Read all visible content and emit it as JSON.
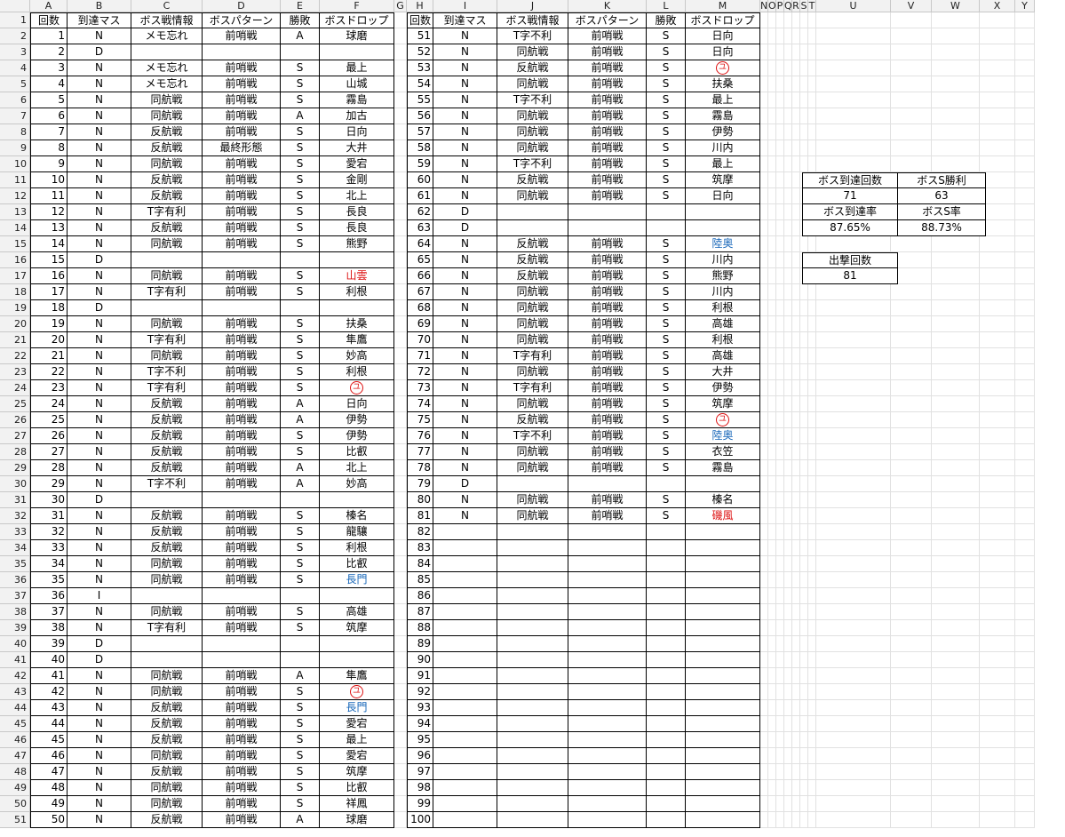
{
  "columns": [
    "A",
    "B",
    "C",
    "D",
    "E",
    "F",
    "G",
    "H",
    "I",
    "J",
    "K",
    "L",
    "M",
    "N",
    "O",
    "P",
    "Q",
    "R",
    "S",
    "T",
    "U",
    "V",
    "W",
    "X",
    "Y"
  ],
  "header1": [
    "回数",
    "到達マス",
    "ボス戦情報",
    "ボスパターン",
    "勝敗",
    "ボスドロップ"
  ],
  "table1": [
    [
      1,
      "N",
      "メモ忘れ",
      "前哨戦",
      "A",
      "球磨"
    ],
    [
      2,
      "D",
      "",
      "",
      "",
      ""
    ],
    [
      3,
      "N",
      "メモ忘れ",
      "前哨戦",
      "S",
      "最上"
    ],
    [
      4,
      "N",
      "メモ忘れ",
      "前哨戦",
      "S",
      "山城"
    ],
    [
      5,
      "N",
      "同航戦",
      "前哨戦",
      "S",
      "霧島"
    ],
    [
      6,
      "N",
      "同航戦",
      "前哨戦",
      "A",
      "加古"
    ],
    [
      7,
      "N",
      "反航戦",
      "前哨戦",
      "S",
      "日向"
    ],
    [
      8,
      "N",
      "反航戦",
      "最終形態",
      "S",
      "大井"
    ],
    [
      9,
      "N",
      "同航戦",
      "前哨戦",
      "S",
      "愛宕"
    ],
    [
      10,
      "N",
      "反航戦",
      "前哨戦",
      "S",
      "金剛"
    ],
    [
      11,
      "N",
      "反航戦",
      "前哨戦",
      "S",
      "北上"
    ],
    [
      12,
      "N",
      "T字有利",
      "前哨戦",
      "S",
      "長良"
    ],
    [
      13,
      "N",
      "反航戦",
      "前哨戦",
      "S",
      "長良"
    ],
    [
      14,
      "N",
      "同航戦",
      "前哨戦",
      "S",
      "熊野"
    ],
    [
      15,
      "D",
      "",
      "",
      "",
      ""
    ],
    [
      16,
      "N",
      "同航戦",
      "前哨戦",
      "S",
      "山雲"
    ],
    [
      17,
      "N",
      "T字有利",
      "前哨戦",
      "S",
      "利根"
    ],
    [
      18,
      "D",
      "",
      "",
      "",
      ""
    ],
    [
      19,
      "N",
      "同航戦",
      "前哨戦",
      "S",
      "扶桑"
    ],
    [
      20,
      "N",
      "T字有利",
      "前哨戦",
      "S",
      "隼鷹"
    ],
    [
      21,
      "N",
      "同航戦",
      "前哨戦",
      "S",
      "妙高"
    ],
    [
      22,
      "N",
      "T字不利",
      "前哨戦",
      "S",
      "利根"
    ],
    [
      23,
      "N",
      "T字有利",
      "前哨戦",
      "S",
      "ユ"
    ],
    [
      24,
      "N",
      "反航戦",
      "前哨戦",
      "A",
      "日向"
    ],
    [
      25,
      "N",
      "反航戦",
      "前哨戦",
      "A",
      "伊勢"
    ],
    [
      26,
      "N",
      "反航戦",
      "前哨戦",
      "S",
      "伊勢"
    ],
    [
      27,
      "N",
      "反航戦",
      "前哨戦",
      "S",
      "比叡"
    ],
    [
      28,
      "N",
      "反航戦",
      "前哨戦",
      "A",
      "北上"
    ],
    [
      29,
      "N",
      "T字不利",
      "前哨戦",
      "A",
      "妙高"
    ],
    [
      30,
      "D",
      "",
      "",
      "",
      ""
    ],
    [
      31,
      "N",
      "反航戦",
      "前哨戦",
      "S",
      "榛名"
    ],
    [
      32,
      "N",
      "反航戦",
      "前哨戦",
      "S",
      "龍驤"
    ],
    [
      33,
      "N",
      "反航戦",
      "前哨戦",
      "S",
      "利根"
    ],
    [
      34,
      "N",
      "同航戦",
      "前哨戦",
      "S",
      "比叡"
    ],
    [
      35,
      "N",
      "同航戦",
      "前哨戦",
      "S",
      "長門"
    ],
    [
      36,
      "I",
      "",
      "",
      "",
      ""
    ],
    [
      37,
      "N",
      "同航戦",
      "前哨戦",
      "S",
      "高雄"
    ],
    [
      38,
      "N",
      "T字有利",
      "前哨戦",
      "S",
      "筑摩"
    ],
    [
      39,
      "D",
      "",
      "",
      "",
      ""
    ],
    [
      40,
      "D",
      "",
      "",
      "",
      ""
    ],
    [
      41,
      "N",
      "同航戦",
      "前哨戦",
      "A",
      "隼鷹"
    ],
    [
      42,
      "N",
      "同航戦",
      "前哨戦",
      "S",
      "ユ"
    ],
    [
      43,
      "N",
      "反航戦",
      "前哨戦",
      "S",
      "長門"
    ],
    [
      44,
      "N",
      "反航戦",
      "前哨戦",
      "S",
      "愛宕"
    ],
    [
      45,
      "N",
      "反航戦",
      "前哨戦",
      "S",
      "最上"
    ],
    [
      46,
      "N",
      "同航戦",
      "前哨戦",
      "S",
      "愛宕"
    ],
    [
      47,
      "N",
      "反航戦",
      "前哨戦",
      "S",
      "筑摩"
    ],
    [
      48,
      "N",
      "同航戦",
      "前哨戦",
      "S",
      "比叡"
    ],
    [
      49,
      "N",
      "同航戦",
      "前哨戦",
      "S",
      "祥鳳"
    ],
    [
      50,
      "N",
      "反航戦",
      "前哨戦",
      "A",
      "球磨"
    ]
  ],
  "table2": [
    [
      51,
      "N",
      "T字不利",
      "前哨戦",
      "S",
      "日向"
    ],
    [
      52,
      "N",
      "同航戦",
      "前哨戦",
      "S",
      "日向"
    ],
    [
      53,
      "N",
      "反航戦",
      "前哨戦",
      "S",
      "ユ"
    ],
    [
      54,
      "N",
      "同航戦",
      "前哨戦",
      "S",
      "扶桑"
    ],
    [
      55,
      "N",
      "T字不利",
      "前哨戦",
      "S",
      "最上"
    ],
    [
      56,
      "N",
      "同航戦",
      "前哨戦",
      "S",
      "霧島"
    ],
    [
      57,
      "N",
      "同航戦",
      "前哨戦",
      "S",
      "伊勢"
    ],
    [
      58,
      "N",
      "同航戦",
      "前哨戦",
      "S",
      "川内"
    ],
    [
      59,
      "N",
      "T字不利",
      "前哨戦",
      "S",
      "最上"
    ],
    [
      60,
      "N",
      "反航戦",
      "前哨戦",
      "S",
      "筑摩"
    ],
    [
      61,
      "N",
      "同航戦",
      "前哨戦",
      "S",
      "日向"
    ],
    [
      62,
      "D",
      "",
      "",
      "",
      ""
    ],
    [
      63,
      "D",
      "",
      "",
      "",
      ""
    ],
    [
      64,
      "N",
      "反航戦",
      "前哨戦",
      "S",
      "陸奥"
    ],
    [
      65,
      "N",
      "反航戦",
      "前哨戦",
      "S",
      "川内"
    ],
    [
      66,
      "N",
      "反航戦",
      "前哨戦",
      "S",
      "熊野"
    ],
    [
      67,
      "N",
      "同航戦",
      "前哨戦",
      "S",
      "川内"
    ],
    [
      68,
      "N",
      "同航戦",
      "前哨戦",
      "S",
      "利根"
    ],
    [
      69,
      "N",
      "同航戦",
      "前哨戦",
      "S",
      "高雄"
    ],
    [
      70,
      "N",
      "同航戦",
      "前哨戦",
      "S",
      "利根"
    ],
    [
      71,
      "N",
      "T字有利",
      "前哨戦",
      "S",
      "高雄"
    ],
    [
      72,
      "N",
      "同航戦",
      "前哨戦",
      "S",
      "大井"
    ],
    [
      73,
      "N",
      "T字有利",
      "前哨戦",
      "S",
      "伊勢"
    ],
    [
      74,
      "N",
      "同航戦",
      "前哨戦",
      "S",
      "筑摩"
    ],
    [
      75,
      "N",
      "反航戦",
      "前哨戦",
      "S",
      "ユ"
    ],
    [
      76,
      "N",
      "T字不利",
      "前哨戦",
      "S",
      "陸奥"
    ],
    [
      77,
      "N",
      "同航戦",
      "前哨戦",
      "S",
      "衣笠"
    ],
    [
      78,
      "N",
      "同航戦",
      "前哨戦",
      "S",
      "霧島"
    ],
    [
      79,
      "D",
      "",
      "",
      "",
      ""
    ],
    [
      80,
      "N",
      "同航戦",
      "前哨戦",
      "S",
      "榛名"
    ],
    [
      81,
      "N",
      "同航戦",
      "前哨戦",
      "S",
      "磯風"
    ],
    [
      82,
      "",
      "",
      "",
      "",
      ""
    ],
    [
      83,
      "",
      "",
      "",
      "",
      ""
    ],
    [
      84,
      "",
      "",
      "",
      "",
      ""
    ],
    [
      85,
      "",
      "",
      "",
      "",
      ""
    ],
    [
      86,
      "",
      "",
      "",
      "",
      ""
    ],
    [
      87,
      "",
      "",
      "",
      "",
      ""
    ],
    [
      88,
      "",
      "",
      "",
      "",
      ""
    ],
    [
      89,
      "",
      "",
      "",
      "",
      ""
    ],
    [
      90,
      "",
      "",
      "",
      "",
      ""
    ],
    [
      91,
      "",
      "",
      "",
      "",
      ""
    ],
    [
      92,
      "",
      "",
      "",
      "",
      ""
    ],
    [
      93,
      "",
      "",
      "",
      "",
      ""
    ],
    [
      94,
      "",
      "",
      "",
      "",
      ""
    ],
    [
      95,
      "",
      "",
      "",
      "",
      ""
    ],
    [
      96,
      "",
      "",
      "",
      "",
      ""
    ],
    [
      97,
      "",
      "",
      "",
      "",
      ""
    ],
    [
      98,
      "",
      "",
      "",
      "",
      ""
    ],
    [
      99,
      "",
      "",
      "",
      "",
      ""
    ],
    [
      100,
      "",
      "",
      "",
      "",
      ""
    ]
  ],
  "dropColors": {
    "山雲": "#d11",
    "磯風": "#d11",
    "ユ": "#d11",
    "長門": "#1565b8",
    "陸奥": "#1565b8"
  },
  "summary": {
    "boss_reach_label": "ボス到達回数",
    "boss_reach": "71",
    "boss_s_label": "ボスS勝利",
    "boss_s": "63",
    "reach_rate_label": "ボス到達率",
    "reach_rate": "87.65%",
    "s_rate_label": "ボスS率",
    "s_rate": "88.73%",
    "sortie_label": "出撃回数",
    "sortie": "81"
  }
}
